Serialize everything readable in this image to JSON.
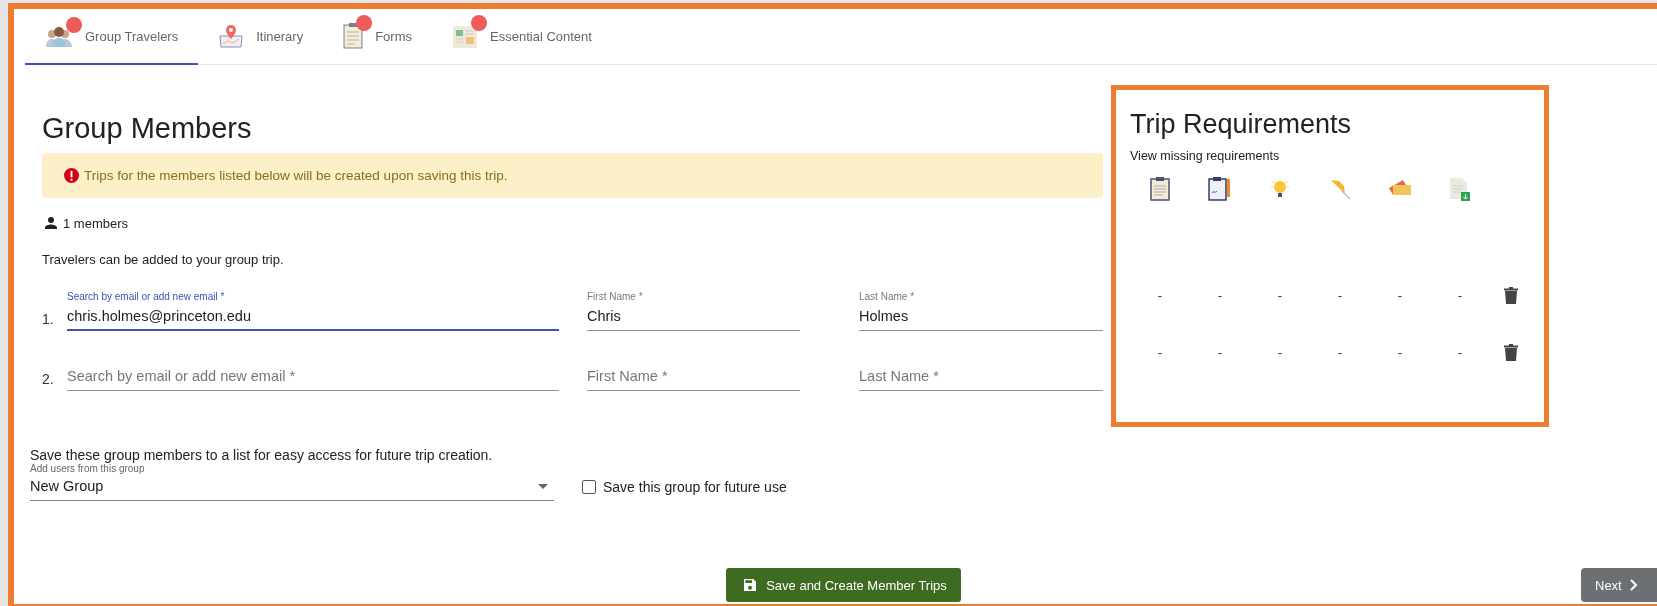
{
  "tabs": [
    {
      "label": "Group Travelers",
      "selected": true,
      "alert": true
    },
    {
      "label": "Itinerary",
      "selected": false,
      "alert": false
    },
    {
      "label": "Forms",
      "selected": false,
      "alert": true
    },
    {
      "label": "Essential Content",
      "selected": false,
      "alert": true
    }
  ],
  "heading": "Group Members",
  "notice": "Trips for the members listed below will be created upon saving this trip.",
  "member_count": "1 members",
  "intro": "Travelers can be added to your group trip.",
  "members": [
    {
      "number": "1.",
      "fields": [
        {
          "label": "Search by email or add new email *",
          "value": "chris.holmes@princeton.edu",
          "focused": true
        },
        {
          "label": "First Name *",
          "value": "Chris",
          "focused": false
        },
        {
          "label": "Last Name *",
          "value": "Holmes",
          "focused": false
        }
      ]
    },
    {
      "number": "2.",
      "fields": [
        {
          "placeholder": "Search by email or add new email *",
          "focused": false
        },
        {
          "placeholder": "First Name *",
          "focused": false
        },
        {
          "placeholder": "Last Name *",
          "focused": false
        }
      ]
    }
  ],
  "requirements": {
    "title": "Trip Requirements",
    "subtitle": "View missing requirements",
    "rows": [
      {
        "cells": [
          "-",
          "-",
          "-",
          "-",
          "-",
          "-"
        ]
      },
      {
        "cells": [
          "-",
          "-",
          "-",
          "-",
          "-",
          "-"
        ]
      }
    ]
  },
  "save_list": {
    "text": "Save these group members to a list for easy access for future trip creation.",
    "select_label": "Add users from this group",
    "select_value": "New Group",
    "checkbox_label": "Save this group for future use",
    "checked": false
  },
  "save_button": "Save and Create Member Trips",
  "next_button": "Next"
}
